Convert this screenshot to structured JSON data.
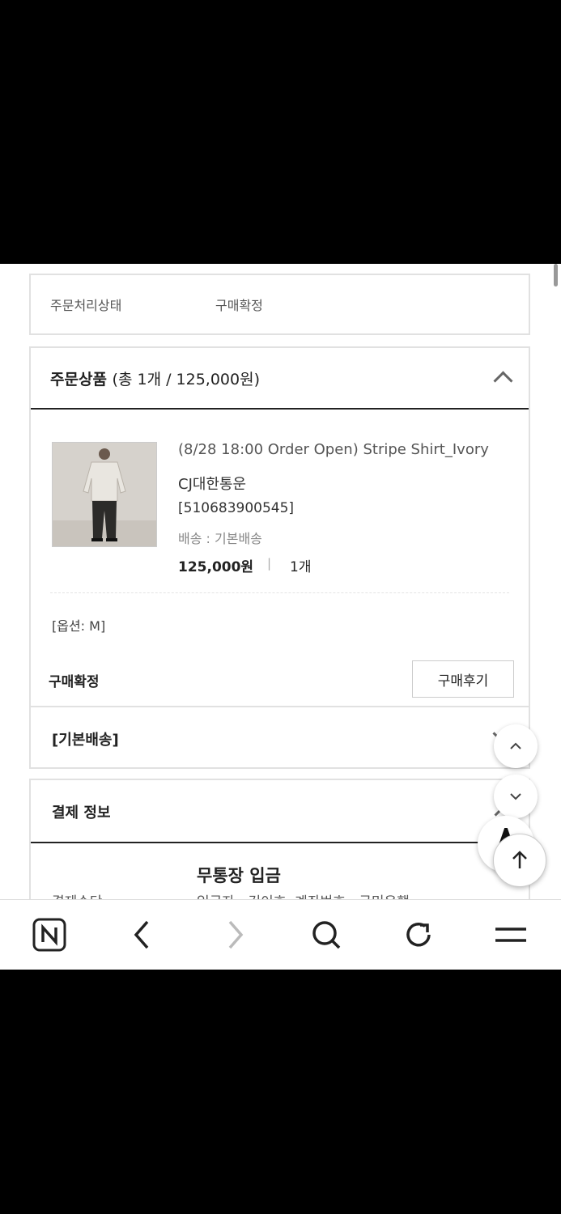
{
  "order_status": {
    "label": "주문처리상태",
    "value": "구매확정"
  },
  "order_items": {
    "title": "주문상품",
    "summary": "(총 1개 / 125,000원)",
    "product": {
      "name": "(8/28 18:00 Order Open) Stripe Shirt_Ivory",
      "courier": "CJ대한통운",
      "tracking": "[510683900545]",
      "shipping": "배송 : 기본배송",
      "price": "125,000원",
      "separator": "|",
      "quantity": "1개",
      "option": "[옵션: M]",
      "status": "구매확정",
      "review_button": "구매후기"
    }
  },
  "shipping_section": {
    "title": "[기본배송]"
  },
  "payment": {
    "title": "결제 정보",
    "method_label": "결제수단",
    "method": "무통장 입금",
    "detail": "입금자 : 김이호, 계좌번호 : 국민은행"
  },
  "icons": {
    "collapse": "chevron-up-icon",
    "expand": "chevron-down-icon",
    "scroll_top": "arrow-up-icon",
    "browser": [
      "naver-home-icon",
      "back-icon",
      "forward-icon",
      "search-icon",
      "refresh-icon",
      "menu-icon"
    ]
  }
}
